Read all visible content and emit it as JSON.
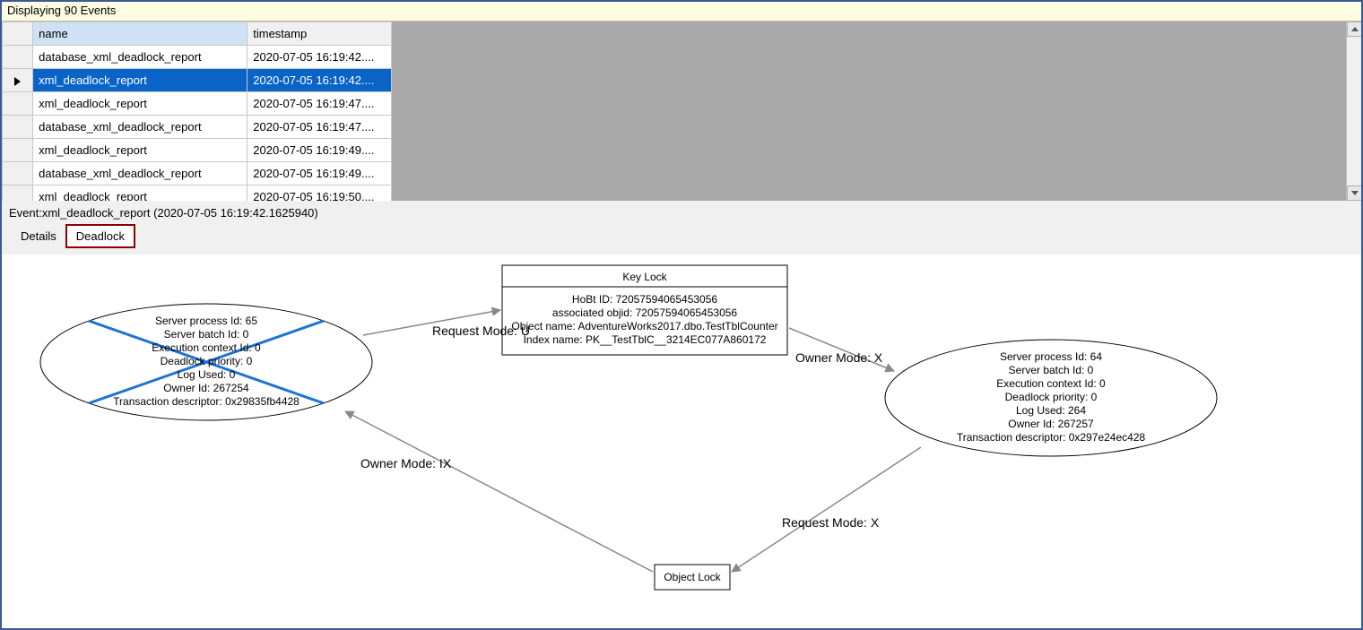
{
  "banner": {
    "text": "Displaying 90 Events"
  },
  "grid": {
    "columns": {
      "name": "name",
      "timestamp": "timestamp"
    },
    "selected_index": 1,
    "rows": [
      {
        "name": "database_xml_deadlock_report",
        "timestamp": "2020-07-05 16:19:42...."
      },
      {
        "name": "xml_deadlock_report",
        "timestamp": "2020-07-05 16:19:42...."
      },
      {
        "name": "xml_deadlock_report",
        "timestamp": "2020-07-05 16:19:47...."
      },
      {
        "name": "database_xml_deadlock_report",
        "timestamp": "2020-07-05 16:19:47...."
      },
      {
        "name": "xml_deadlock_report",
        "timestamp": "2020-07-05 16:19:49...."
      },
      {
        "name": "database_xml_deadlock_report",
        "timestamp": "2020-07-05 16:19:49...."
      },
      {
        "name": "xml_deadlock_report",
        "timestamp": "2020-07-05 16:19:50...."
      }
    ]
  },
  "detail": {
    "label": "Event:xml_deadlock_report (2020-07-05 16:19:42.1625940)",
    "tabs": {
      "details": "Details",
      "deadlock": "Deadlock",
      "active": "deadlock"
    }
  },
  "diagram": {
    "key_lock": {
      "title": "Key Lock",
      "lines": [
        "HoBt ID: 72057594065453056",
        "associated objid: 72057594065453056",
        "Object name: AdventureWorks2017.dbo.TestTblCounter",
        "Index name: PK__TestTblC__3214EC077A860172"
      ]
    },
    "object_lock": {
      "title": "Object Lock"
    },
    "process_left": {
      "lines": [
        "Server process Id: 65",
        "Server batch Id: 0",
        "Execution context Id: 0",
        "Deadlock priority: 0",
        "Log Used: 0",
        "Owner Id: 267254",
        "Transaction descriptor: 0x29835fb4428"
      ]
    },
    "process_right": {
      "lines": [
        "Server process Id: 64",
        "Server batch Id: 0",
        "Execution context Id: 0",
        "Deadlock priority: 0",
        "Log Used: 264",
        "Owner Id: 267257",
        "Transaction descriptor: 0x297e24ec428"
      ]
    },
    "edges": {
      "req_u": "Request Mode: U",
      "own_x": "Owner Mode: X",
      "own_ix": "Owner Mode: IX",
      "req_x": "Request Mode: X"
    }
  }
}
